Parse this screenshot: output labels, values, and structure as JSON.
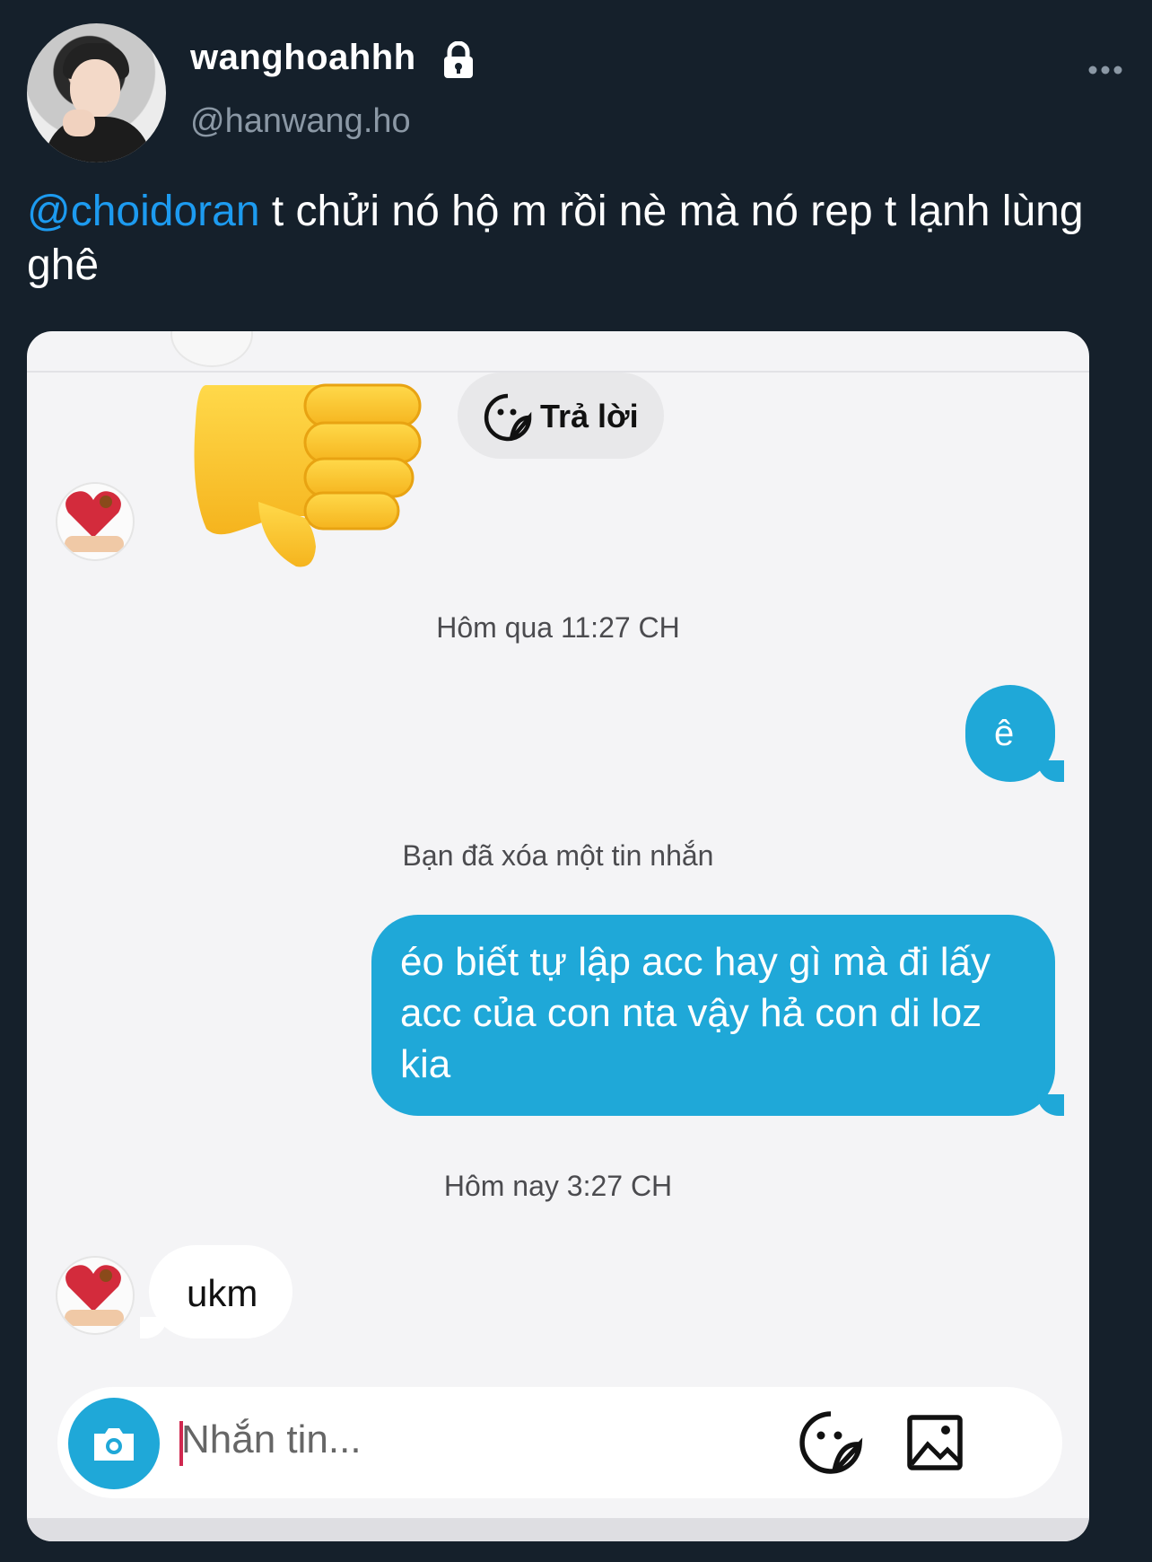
{
  "tweet": {
    "display_name": "wanghoahhh",
    "handle": "@hanwang.ho",
    "mention": "@choidoran",
    "text": " t chửi nó hộ m rồi nè mà nó rep t lạnh lùng ghê",
    "icons": [
      "lock-icon",
      "more-icon"
    ]
  },
  "chat": {
    "reply_chip_label": "Trả lời",
    "timestamp_1": "Hôm qua 11:27 CH",
    "outgoing_1": "ê",
    "system_note": "Bạn đã xóa một tin nhắn",
    "outgoing_2": "éo biết tự lập acc hay gì mà đi lấy acc của con nta vậy hả con di loz kia",
    "timestamp_2": "Hôm nay 3:27 CH",
    "incoming_1": "ukm",
    "composer_placeholder": "Nhắn tin...",
    "sticker": "thumbs-down-emoji",
    "colors": {
      "bubble_out": "#1fa8d8",
      "bubble_in": "#ffffff",
      "chat_bg": "#f4f4f6",
      "mention": "#1d9bf0",
      "page_bg": "#15202b"
    }
  }
}
